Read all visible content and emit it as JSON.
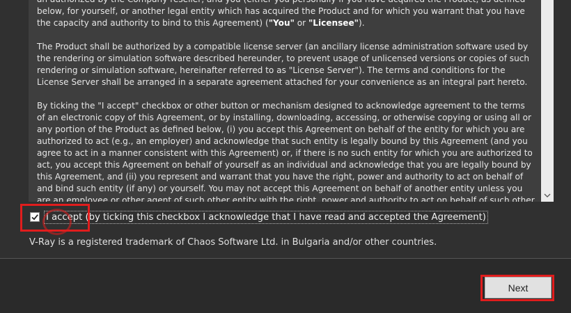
{
  "license": {
    "paragraph1_part1": "an authorized by the Company reseller, and you (either you personally if you have acquired the Product, as defined below, for yourself, or another legal entity which has acquired the Product and for which you warrant that you have the capacity and authority to bind to this Agreement) (",
    "you_term": "\"You\"",
    "or_word": " or ",
    "licensee_term": "\"Licensee\"",
    "paragraph1_end": ").",
    "paragraph2": "The Product shall be authorized by a compatible license server (an ancillary license administration software used by the rendering or simulation software described hereunder, to prevent usage of unlicensed versions or copies of such rendering or simulation software, hereinafter referred to as \"License Server\"). The terms and conditions for the License Server shall be arranged in a separate agreement attached for your convenience as an integral part hereto.",
    "paragraph3": "By ticking the \"I accept\" checkbox or other button or mechanism designed to acknowledge agreement to the terms of an electronic copy of this Agreement, or by installing, downloading, accessing, or otherwise copying or using all or any portion of the Product as defined below, (i) you accept this Agreement on behalf of the entity for which you are authorized to act (e.g., an employer) and acknowledge that such entity is legally bound by this Agreement (and you agree to act in a manner consistent with this Agreement) or, if there is no such entity for which you are authorized to act, you accept this Agreement on behalf of yourself as an individual and acknowledge that you are legally bound by this Agreement, and (ii) you represent and warrant that you have the right, power and authority to act on behalf of and bind such entity (if any) or yourself. You may not accept this Agreement on behalf of another entity unless you are an employee or other agent of such other entity with the right, power and authority to act on behalf of such other entity."
  },
  "accept": {
    "checked": true,
    "label": "I accept (by ticking this checkbox I acknowledge that I have read and accepted the Agreement)"
  },
  "trademark": "V-Ray is a registered trademark of Chaos Software Ltd. in Bulgaria and/or other countries.",
  "buttons": {
    "next": "Next"
  },
  "colors": {
    "highlight": "#e11d1d",
    "panel": "#3e3e3e",
    "background": "#303030"
  }
}
